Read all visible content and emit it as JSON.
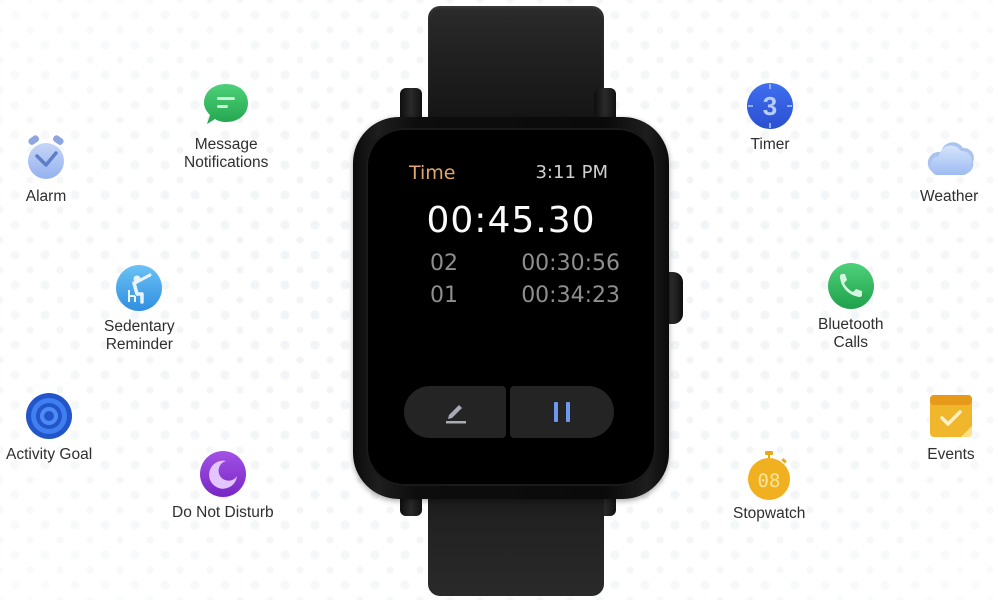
{
  "watch": {
    "app_title": "Time",
    "clock": "3:11 PM",
    "stopwatch_time": "00:45.30",
    "laps": [
      {
        "number": "02",
        "time": "00:30:56"
      },
      {
        "number": "01",
        "time": "00:34:23"
      }
    ],
    "buttons": {
      "edit_icon": "pencil-icon",
      "pause_icon": "pause-icon"
    },
    "colors": {
      "title": "#e2a66a",
      "pause": "#6f97f0",
      "screen": "#000000"
    }
  },
  "features": {
    "left": [
      {
        "label": "Alarm",
        "icon": "alarm-clock-icon"
      },
      {
        "label": "Message\nNotifications",
        "icon": "message-bubble-icon"
      },
      {
        "label": "Sedentary\nReminder",
        "icon": "sedentary-person-icon"
      },
      {
        "label": "Activity Goal",
        "icon": "target-icon"
      },
      {
        "label": "Do Not Disturb",
        "icon": "moon-icon"
      }
    ],
    "right": [
      {
        "label": "Timer",
        "icon": "timer-icon",
        "timer_digit": "3"
      },
      {
        "label": "Weather",
        "icon": "cloud-icon"
      },
      {
        "label": "Bluetooth\nCalls",
        "icon": "phone-icon"
      },
      {
        "label": "Events",
        "icon": "calendar-check-icon"
      },
      {
        "label": "Stopwatch",
        "icon": "stopwatch-icon",
        "stopwatch_digits": "08"
      }
    ]
  }
}
